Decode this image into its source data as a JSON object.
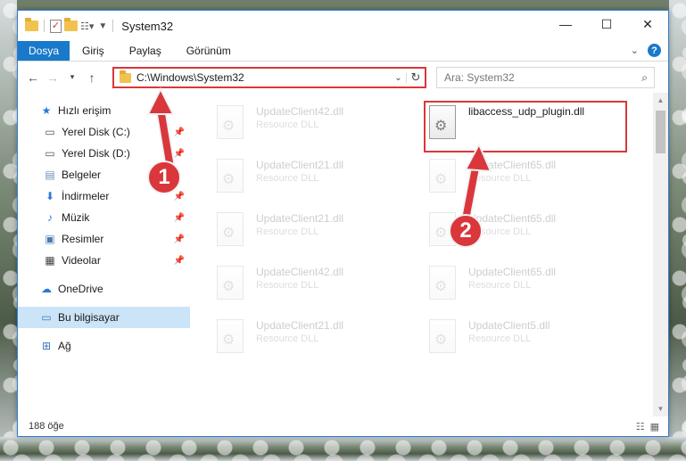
{
  "window": {
    "title": "System32",
    "minimize": "—",
    "maximize": "☐",
    "close": "✕"
  },
  "ribbon": {
    "tabs": [
      "Dosya",
      "Giriş",
      "Paylaş",
      "Görünüm"
    ],
    "help": "?"
  },
  "nav": {
    "address": "C:\\Windows\\System32",
    "search_placeholder": "Ara: System32"
  },
  "sidebar": {
    "items": [
      {
        "label": "Hızlı erişim",
        "icon": "star-icon"
      },
      {
        "label": "Yerel Disk (C:)",
        "icon": "drive-icon"
      },
      {
        "label": "Yerel Disk (D:)",
        "icon": "drive-icon"
      },
      {
        "label": "Belgeler",
        "icon": "documents-icon"
      },
      {
        "label": "İndirmeler",
        "icon": "download-icon"
      },
      {
        "label": "Müzik",
        "icon": "music-icon"
      },
      {
        "label": "Resimler",
        "icon": "pictures-icon"
      },
      {
        "label": "Videolar",
        "icon": "videos-icon"
      },
      {
        "label": "OneDrive",
        "icon": "cloud-icon"
      },
      {
        "label": "Bu bilgisayar",
        "icon": "computer-icon"
      },
      {
        "label": "Ağ",
        "icon": "network-icon"
      }
    ]
  },
  "files": [
    {
      "name": "UpdateClient42.dll",
      "desc": "Resource DLL"
    },
    {
      "name": "libaccess_udp_plugin.dll",
      "desc": ""
    },
    {
      "name": "UpdateClient21.dll",
      "desc": "Resource DLL"
    },
    {
      "name": "UpdateClient65.dll",
      "desc": "Resource DLL"
    },
    {
      "name": "UpdateClient21.dll",
      "desc": "Resource DLL"
    },
    {
      "name": "UpdateClient65.dll",
      "desc": "Resource DLL"
    },
    {
      "name": "UpdateClient42.dll",
      "desc": "Resource DLL"
    },
    {
      "name": "UpdateClient65.dll",
      "desc": "Resource DLL"
    },
    {
      "name": "UpdateClient21.dll",
      "desc": "Resource DLL"
    },
    {
      "name": "UpdateClient5.dll",
      "desc": "Resource DLL"
    }
  ],
  "status": {
    "count": "188 öğe"
  },
  "annotations": {
    "step1": "1",
    "step2": "2"
  },
  "colors": {
    "highlight": "#d9373c",
    "accent": "#1979ca"
  }
}
